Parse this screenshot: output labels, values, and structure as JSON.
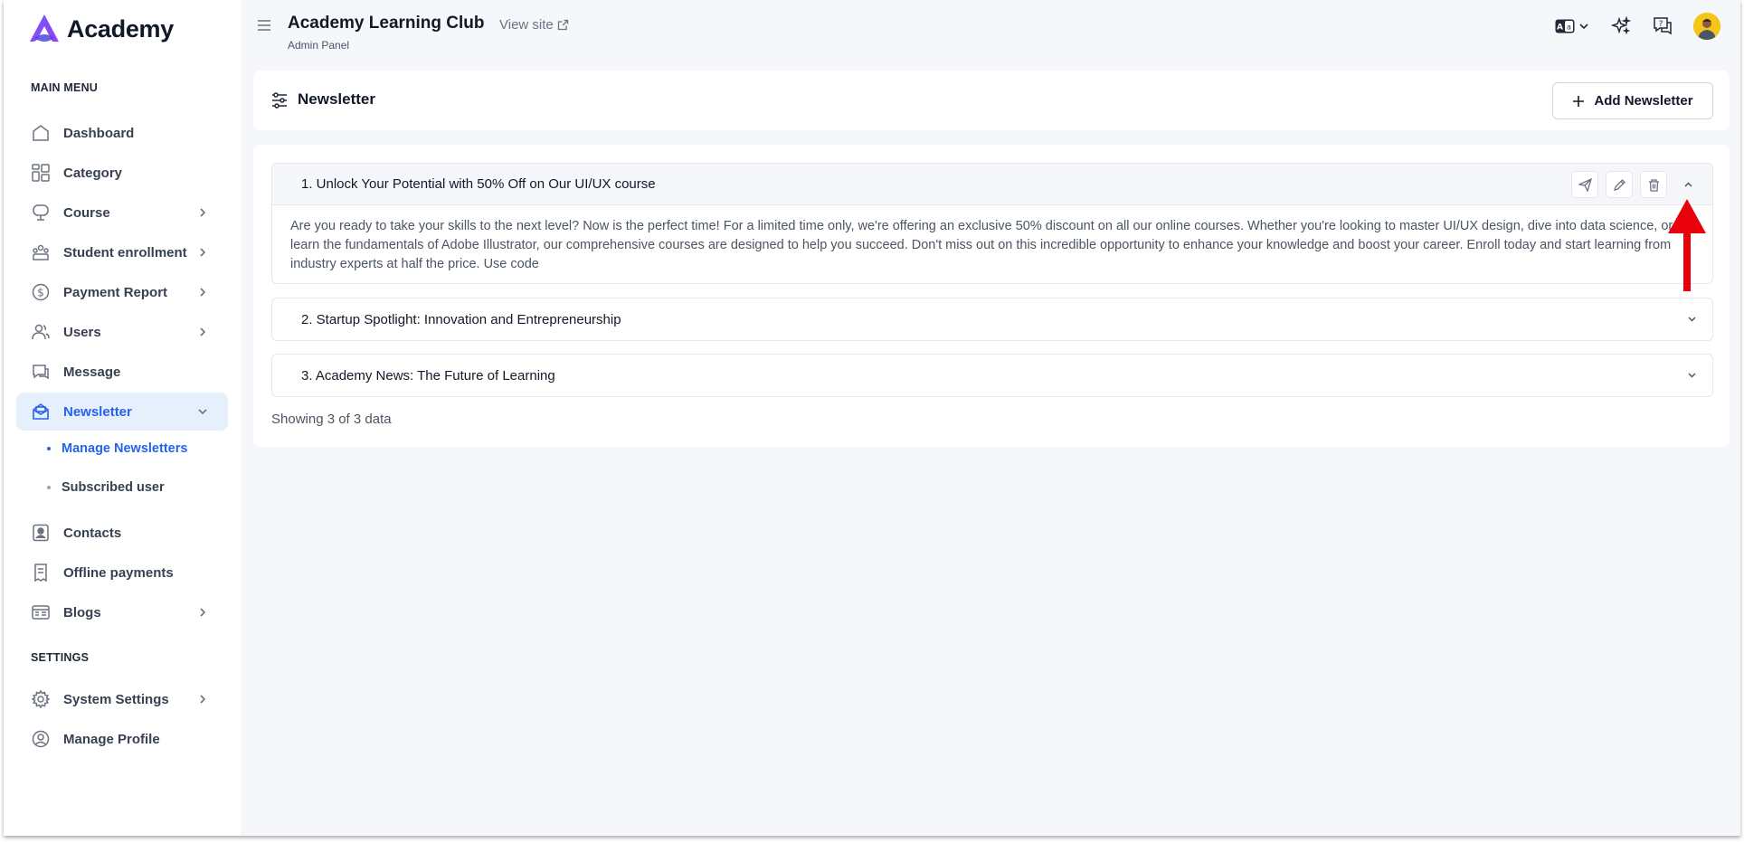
{
  "brand": {
    "name": "Academy"
  },
  "sidebar": {
    "main_menu_title": "MAIN MENU",
    "settings_title": "SETTINGS",
    "items": [
      {
        "label": "Dashboard"
      },
      {
        "label": "Category"
      },
      {
        "label": "Course"
      },
      {
        "label": "Student enrollment"
      },
      {
        "label": "Payment Report"
      },
      {
        "label": "Users"
      },
      {
        "label": "Message"
      },
      {
        "label": "Newsletter"
      },
      {
        "label": "Contacts"
      },
      {
        "label": "Offline payments"
      },
      {
        "label": "Blogs"
      },
      {
        "label": "System Settings"
      },
      {
        "label": "Manage Profile"
      }
    ],
    "newsletter_sub": [
      {
        "label": "Manage Newsletters"
      },
      {
        "label": "Subscribed user"
      }
    ]
  },
  "topbar": {
    "title": "Academy Learning Club",
    "subtitle": "Admin Panel",
    "view_site": "View site"
  },
  "page": {
    "title": "Newsletter",
    "add_button": "Add Newsletter"
  },
  "newsletters": [
    {
      "title": "1. Unlock Your Potential with 50% Off on Our UI/UX course",
      "body": "Are you ready to take your skills to the next level? Now is the perfect time! For a limited time only, we're offering an exclusive 50% discount on all our online courses. Whether you're looking to master UI/UX design, dive into data science, or learn the fundamentals of Adobe Illustrator, our comprehensive courses are designed to help you succeed. Don't miss out on this incredible opportunity to enhance your knowledge and boost your career. Enroll today and start learning from industry experts at half the price. Use code"
    },
    {
      "title": "2. Startup Spotlight: Innovation and Entrepreneurship"
    },
    {
      "title": "3. Academy News: The Future of Learning"
    }
  ],
  "showing_text": "Showing 3 of 3 data",
  "colors": {
    "accent": "#2563eb",
    "active_bg": "#e6f0fd",
    "annotation": "#e8000b"
  }
}
